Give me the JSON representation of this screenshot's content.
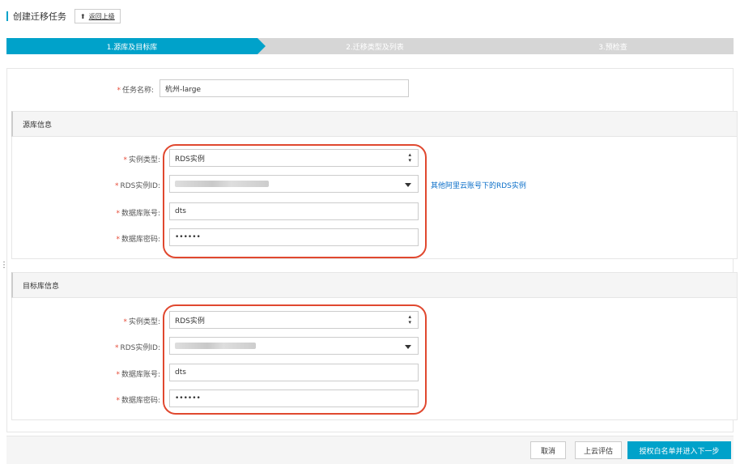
{
  "header": {
    "title": "创建迁移任务",
    "back_label": "返回上级"
  },
  "steps": [
    "1.源库及目标库",
    "2.迁移类型及列表",
    "3.预检查"
  ],
  "task": {
    "label": "任务名称:",
    "value": "杭州-large"
  },
  "source": {
    "section_title": "源库信息",
    "instance_type_label": "实例类型:",
    "instance_type_value": "RDS实例",
    "instance_id_label": "RDS实例ID:",
    "account_label": "数据库账号:",
    "account_value": "dts",
    "password_label": "数据库密码:",
    "password_value": "••••••",
    "other_account_link": "其他阿里云账号下的RDS实例"
  },
  "target": {
    "section_title": "目标库信息",
    "instance_type_label": "实例类型:",
    "instance_type_value": "RDS实例",
    "instance_id_label": "RDS实例ID:",
    "account_label": "数据库账号:",
    "account_value": "dts",
    "password_label": "数据库密码:",
    "password_value": "••••••"
  },
  "footer": {
    "cancel": "取消",
    "evaluate": "上云评估",
    "next": "授权白名单并进入下一步"
  },
  "colors": {
    "accent": "#00a2ca",
    "highlight": "#e0482f",
    "link": "#0a6ec8"
  }
}
